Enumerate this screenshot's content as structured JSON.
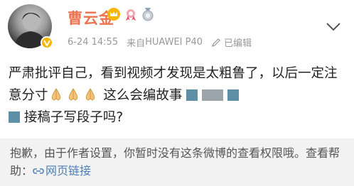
{
  "post": {
    "username": "曹云金",
    "time": "6-24 14:55",
    "source_prefix": "来自",
    "source_device": "HUAWEI P40",
    "edited": "已编辑",
    "text_part1": "严肃批评自己，看到视频才发现是太粗鲁了，以后一定注意分寸",
    "text_part2": "这么会编故事",
    "text_part3": "接稿子写段子吗?",
    "emoji_name": "pray-hands-emoji",
    "accent_color": "#eb7350"
  },
  "notice": {
    "text": "抱歉，由于作者设置，你暂时没有这条微博的查看权限哦。查看帮助：",
    "link_label": "网页链接"
  }
}
